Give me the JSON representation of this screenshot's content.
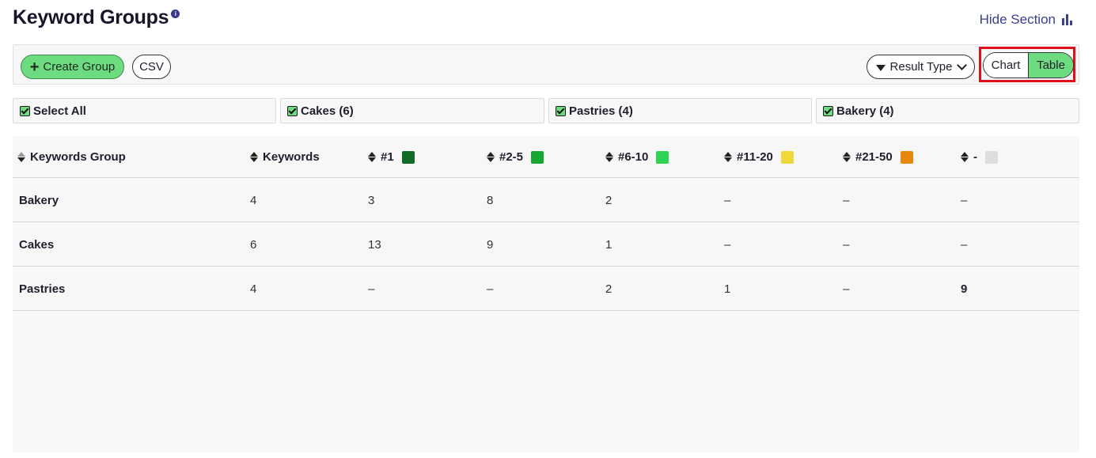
{
  "header": {
    "title": "Keyword Groups",
    "info_icon": "info-icon",
    "hide_section_label": "Hide Section",
    "hide_section_icon": "bar-chart-icon"
  },
  "toolbar": {
    "create_group_label": "Create Group",
    "csv_label": "CSV",
    "result_type_label": "Result Type",
    "view_toggle": {
      "chart_label": "Chart",
      "table_label": "Table",
      "selected": "Table"
    }
  },
  "groups": [
    {
      "label": "Select All",
      "checked": true
    },
    {
      "label": "Cakes (6)",
      "checked": true
    },
    {
      "label": "Pastries (4)",
      "checked": true
    },
    {
      "label": "Bakery (4)",
      "checked": true
    }
  ],
  "table": {
    "columns": [
      {
        "label": "Keywords Group",
        "color": null
      },
      {
        "label": "Keywords",
        "color": null
      },
      {
        "label": "#1",
        "color": "#0f6b25"
      },
      {
        "label": "#2-5",
        "color": "#17a832"
      },
      {
        "label": "#6-10",
        "color": "#2fd353"
      },
      {
        "label": "#11-20",
        "color": "#efd93a"
      },
      {
        "label": "#21-50",
        "color": "#e8870d"
      },
      {
        "label": "-",
        "color": "#dddddd"
      }
    ],
    "rows": [
      {
        "cells": [
          "Bakery",
          "4",
          "3",
          "8",
          "2",
          "–",
          "–",
          "–"
        ]
      },
      {
        "cells": [
          "Cakes",
          "6",
          "13",
          "9",
          "1",
          "–",
          "–",
          "–"
        ]
      },
      {
        "cells": [
          "Pastries",
          "4",
          "–",
          "–",
          "2",
          "1",
          "–",
          "9"
        ]
      }
    ]
  },
  "colors": {
    "accent_green": "#6ddb7f",
    "link_blue": "#3a3f8f",
    "highlight_red": "#e0101a"
  }
}
